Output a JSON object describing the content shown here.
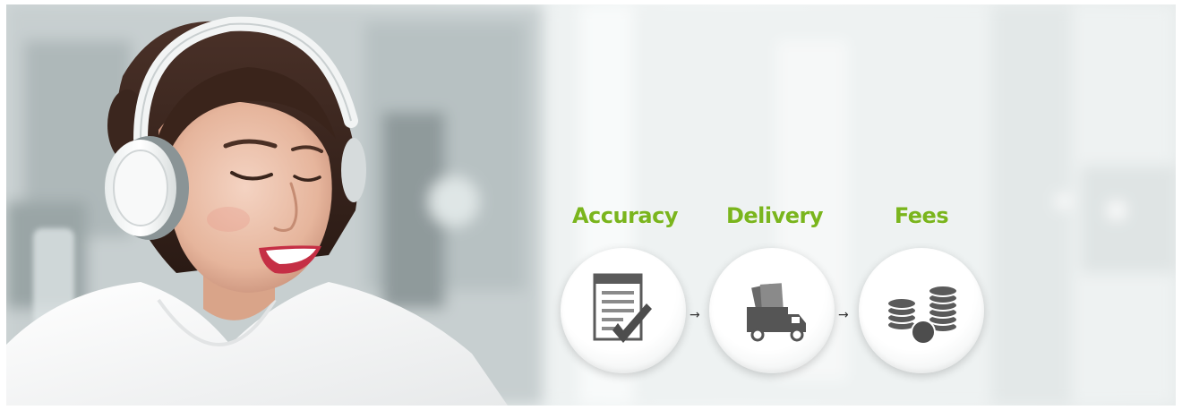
{
  "banner": {
    "steps": [
      {
        "label": "Accuracy",
        "icon": "document-checkmark-icon"
      },
      {
        "label": "Delivery",
        "icon": "delivery-truck-icon"
      },
      {
        "label": "Fees",
        "icon": "coin-stacks-icon"
      }
    ],
    "arrow_glyph": "→",
    "colors": {
      "label_green": "#7ab51d",
      "icon_gray": "#555555",
      "background": "#eef2f2"
    }
  }
}
